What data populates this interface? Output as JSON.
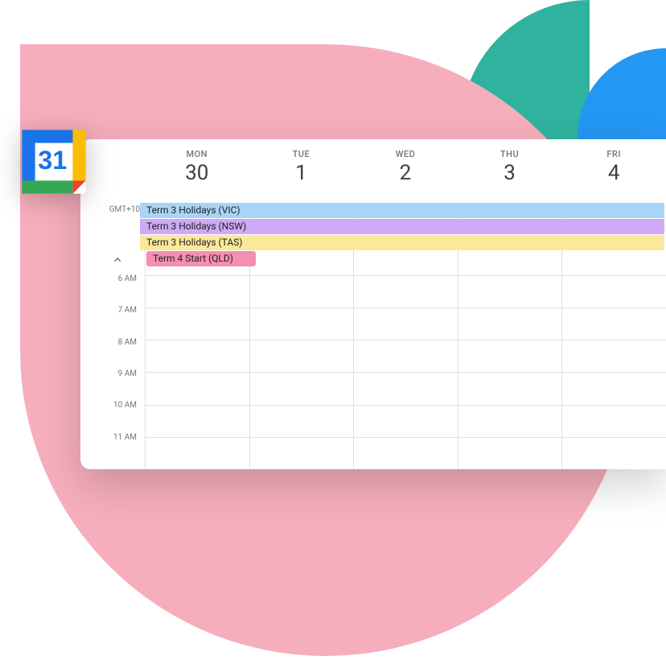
{
  "app_icon": {
    "day_number": "31"
  },
  "calendar": {
    "timezone": "GMT+10",
    "days": [
      {
        "name": "MON",
        "num": "30"
      },
      {
        "name": "TUE",
        "num": "1"
      },
      {
        "name": "WED",
        "num": "2"
      },
      {
        "name": "THU",
        "num": "3"
      },
      {
        "name": "FRI",
        "num": "4"
      }
    ],
    "allday_events": [
      {
        "title": "Term 3 Holidays (VIC)",
        "color": "#a8d5f7",
        "span": "full"
      },
      {
        "title": "Term 3 Holidays (NSW)",
        "color": "#cfa9f5",
        "span": "full"
      },
      {
        "title": "Term 3 Holidays (TAS)",
        "color": "#fce89a",
        "span": "full"
      },
      {
        "title": "Term 4 Start (QLD)",
        "color": "#f48fb1",
        "span": "short"
      }
    ],
    "hours": [
      "6 AM",
      "7 AM",
      "8 AM",
      "9 AM",
      "10 AM",
      "11 AM"
    ]
  }
}
